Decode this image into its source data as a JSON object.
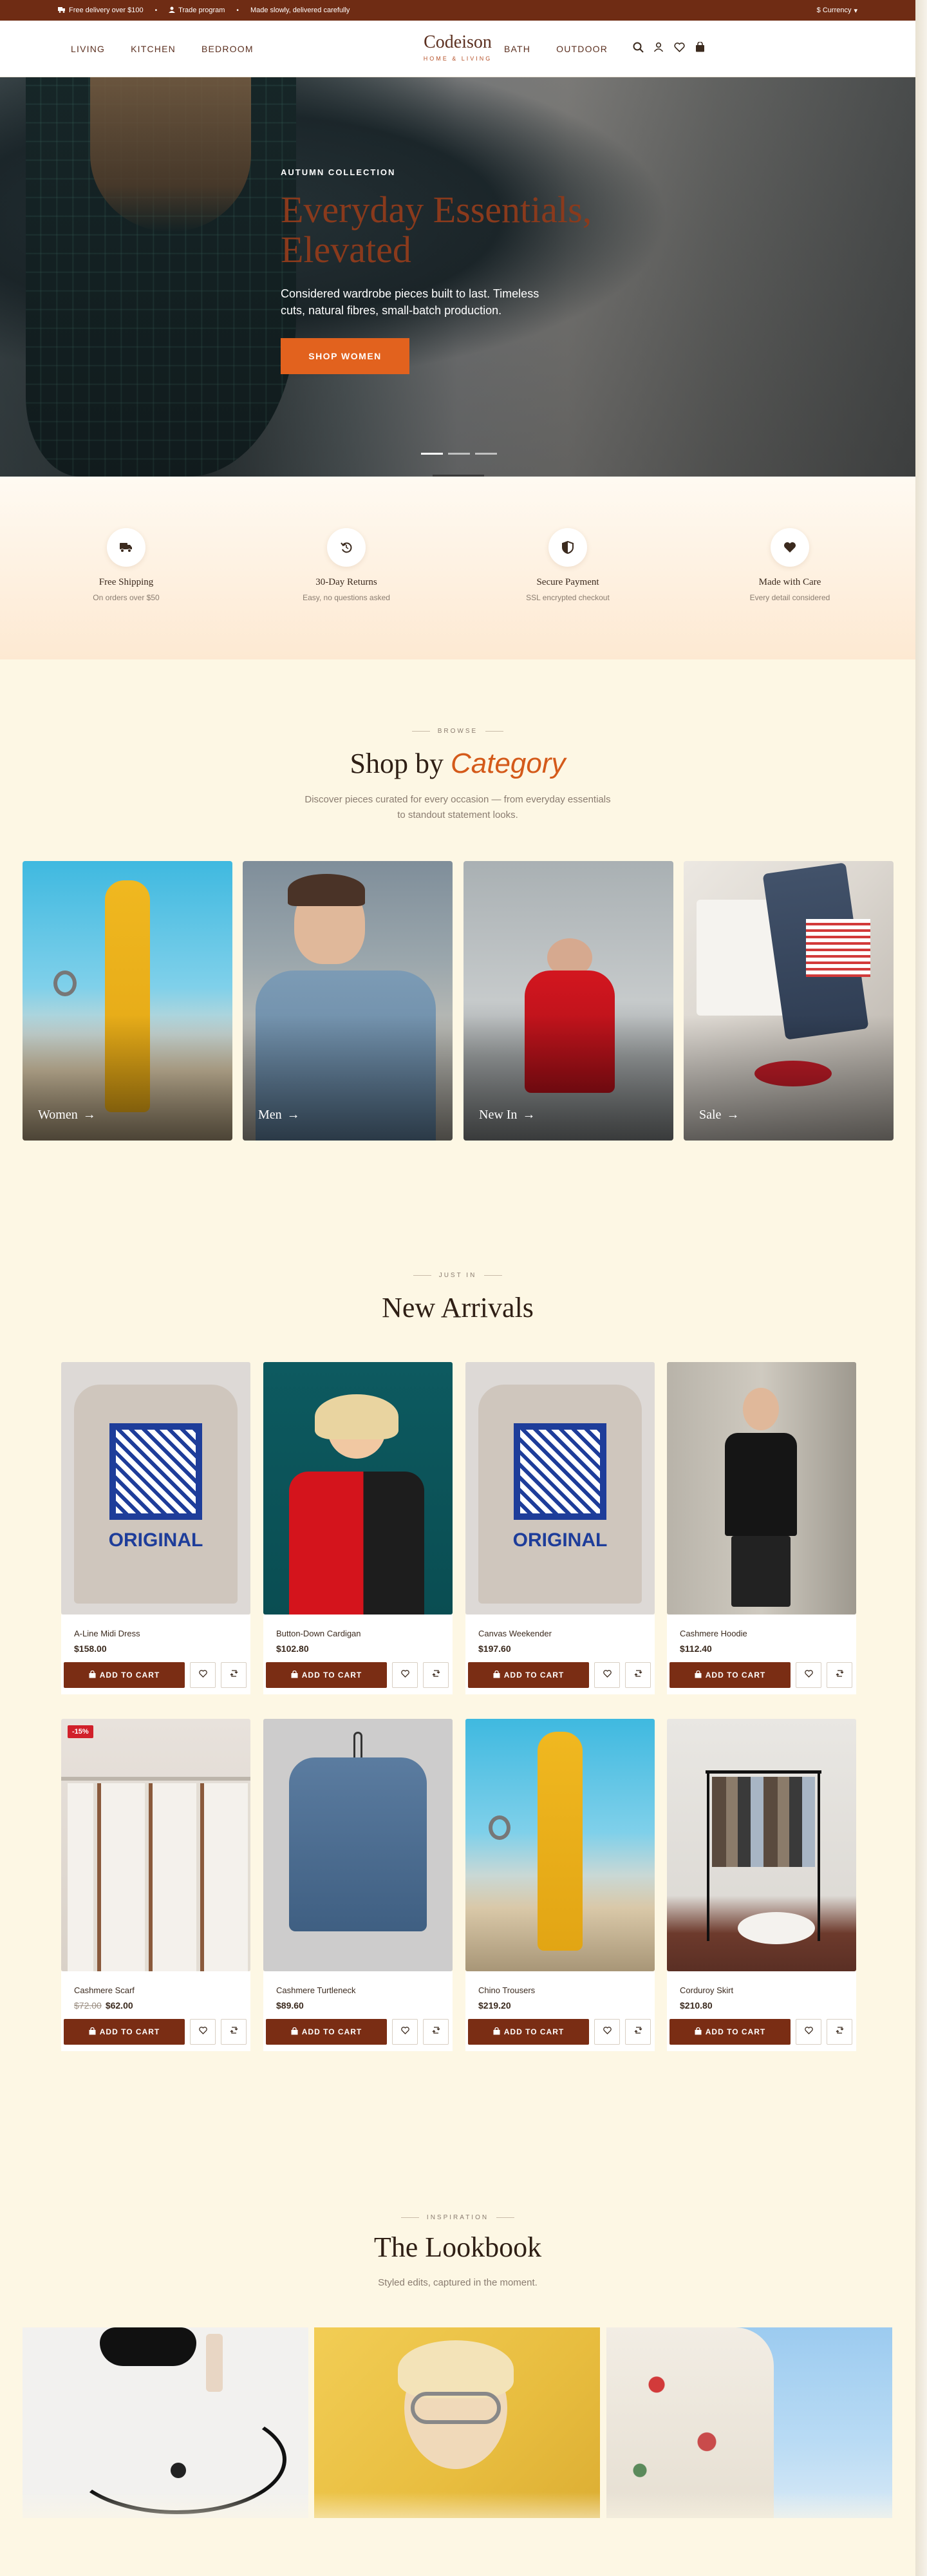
{
  "topbar": {
    "messages": [
      "Free delivery over $100",
      "Trade program",
      "Made slowly, delivered carefully"
    ],
    "currency": "$ Currency"
  },
  "header": {
    "nav_left": [
      "LIVING",
      "KITCHEN",
      "BEDROOM"
    ],
    "nav_right": [
      "BATH",
      "OUTDOOR"
    ],
    "logo": "Codeison",
    "logo_sub": "HOME & LIVING"
  },
  "hero": {
    "eyebrow": "AUTUMN COLLECTION",
    "title": "Everyday Essentials, Elevated",
    "text": "Considered wardrobe pieces built to last. Timeless cuts, natural fibres, small-batch production.",
    "cta": "SHOP WOMEN"
  },
  "features": [
    {
      "title": "Free Shipping",
      "sub": "On orders over $50",
      "icon": "truck-icon"
    },
    {
      "title": "30-Day Returns",
      "sub": "Easy, no questions asked",
      "icon": "return-icon"
    },
    {
      "title": "Secure Payment",
      "sub": "SSL encrypted checkout",
      "icon": "shield-icon"
    },
    {
      "title": "Made with Care",
      "sub": "Every detail considered",
      "icon": "heart-icon"
    }
  ],
  "categories_section": {
    "eyebrow": "BROWSE",
    "title_plain": "Shop by",
    "title_accent": "Category",
    "desc": "Discover pieces curated for every occasion — from everyday essentials to standout statement looks.",
    "items": [
      "Women",
      "Men",
      "New In",
      "Sale"
    ]
  },
  "arrivals_section": {
    "eyebrow": "JUST IN",
    "title": "New Arrivals",
    "add_label": "ADD TO CART",
    "products": [
      {
        "name": "A-Line Midi Dress",
        "price": "$158.00"
      },
      {
        "name": "Button-Down Cardigan",
        "price": "$102.80"
      },
      {
        "name": "Canvas Weekender",
        "price": "$197.60"
      },
      {
        "name": "Cashmere Hoodie",
        "price": "$112.40"
      },
      {
        "name": "Cashmere Scarf",
        "price": "$62.00",
        "old_price": "$72.00",
        "badge": "-15%"
      },
      {
        "name": "Cashmere Turtleneck",
        "price": "$89.60"
      },
      {
        "name": "Chino Trousers",
        "price": "$219.20"
      },
      {
        "name": "Corduroy Skirt",
        "price": "$210.80"
      }
    ]
  },
  "lookbook_section": {
    "eyebrow": "INSPIRATION",
    "title": "The Lookbook",
    "desc": "Styled edits, captured in the moment."
  },
  "colors": {
    "brand": "#6f2c14",
    "accent": "#e2621e",
    "button": "#7a2d14",
    "background": "#fdf7e4"
  }
}
